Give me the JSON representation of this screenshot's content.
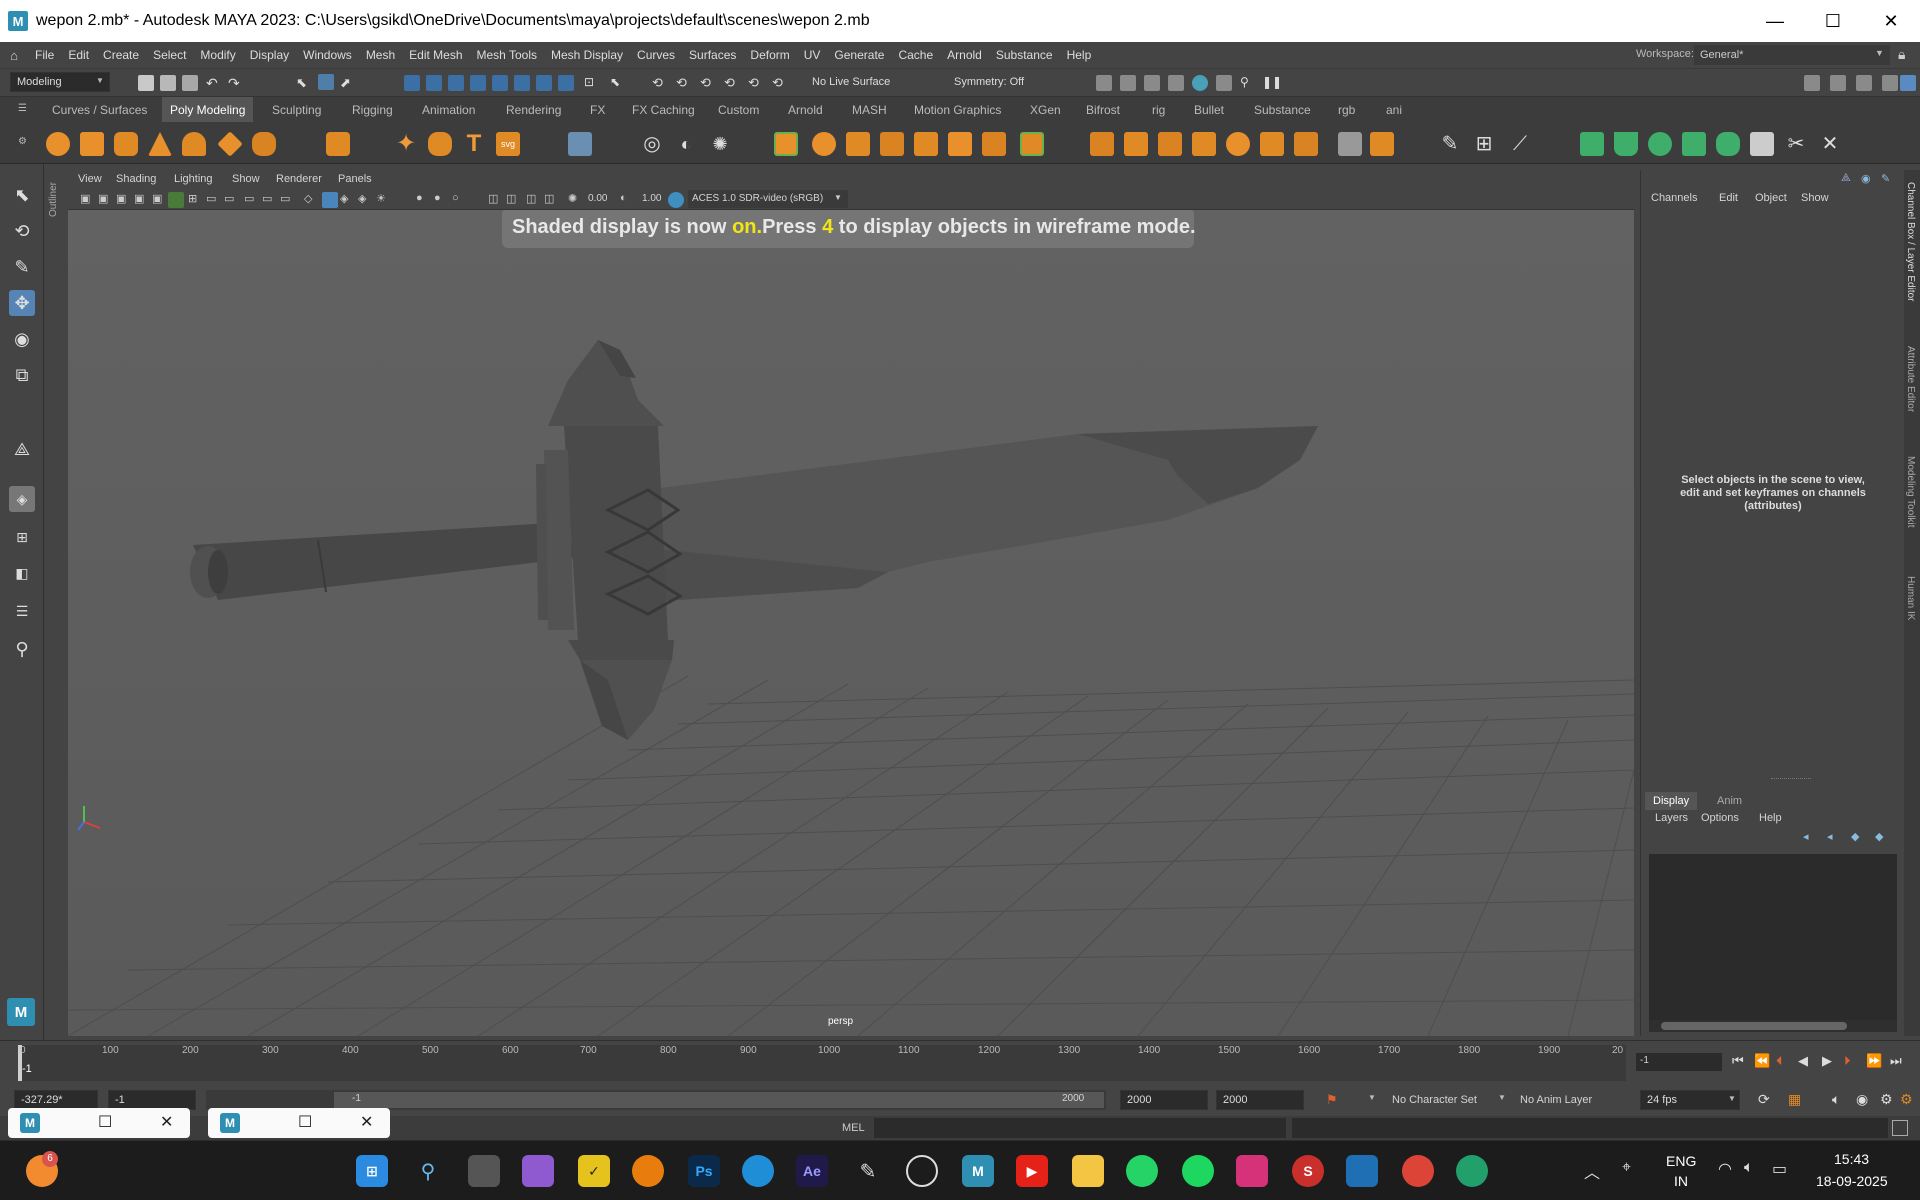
{
  "window": {
    "app_icon": "maya-logo-icon",
    "title": "wepon 2.mb* - Autodesk MAYA 2023: C:\\Users\\gsikd\\OneDrive\\Documents\\maya\\projects\\default\\scenes\\wepon 2.mb",
    "minimize": "—",
    "maximize": "☐",
    "close": "✕"
  },
  "menubar": {
    "items": [
      "File",
      "Edit",
      "Create",
      "Select",
      "Modify",
      "Display",
      "Windows",
      "Mesh",
      "Edit Mesh",
      "Mesh Tools",
      "Mesh Display",
      "Curves",
      "Surfaces",
      "Deform",
      "UV",
      "Generate",
      "Cache",
      "Arnold",
      "Substance",
      "Help"
    ],
    "workspace_label": "Workspace:",
    "workspace_value": "General*"
  },
  "statusline": {
    "menuset": "Modeling",
    "live_surface": "No Live Surface",
    "symmetry": "Symmetry: Off"
  },
  "shelf": {
    "tabs": [
      "Curves / Surfaces",
      "Poly Modeling",
      "Sculpting",
      "Rigging",
      "Animation",
      "Rendering",
      "FX",
      "FX Caching",
      "Custom",
      "Arnold",
      "MASH",
      "Motion Graphics",
      "XGen",
      "Bifrost",
      "rig",
      "Bullet",
      "Substance",
      "rgb",
      "ani"
    ],
    "active_tab": "Poly Modeling"
  },
  "toolbox": {
    "outliner_label": "Outliner"
  },
  "viewport": {
    "menu": [
      "View",
      "Shading",
      "Lighting",
      "Show",
      "Renderer",
      "Panels"
    ],
    "exposure": "0.00",
    "gamma": "1.00",
    "colorspace": "ACES 1.0 SDR-video (sRGB)",
    "hud_part1": "Shaded display is now ",
    "hud_on": "on.",
    "hud_part2": "Press ",
    "hud_key": "4",
    "hud_part3": " to display objects in wireframe mode.",
    "camera": "persp",
    "colors": {
      "hud_highlight": "#f2e417",
      "background": "#5f5f5f",
      "grid": "#4f4f4f"
    }
  },
  "channelbox": {
    "menu": [
      "Channels",
      "Edit",
      "Object",
      "Show"
    ],
    "hint": "Select objects in the scene to view, edit and set keyframes on channels (attributes)",
    "side_tabs": [
      "Channel Box / Layer Editor",
      "Attribute Editor",
      "Modeling Toolkit",
      "Human IK"
    ]
  },
  "layers": {
    "tabs": [
      "Display",
      "Anim"
    ],
    "menu": [
      "Layers",
      "Options",
      "Help"
    ]
  },
  "timeslider": {
    "ticks": [
      "0",
      "100",
      "200",
      "300",
      "400",
      "500",
      "600",
      "700",
      "800",
      "900",
      "1000",
      "1100",
      "1200",
      "1300",
      "1400",
      "1500",
      "1600",
      "1700",
      "1800",
      "1900",
      "20"
    ],
    "current_left": "-1",
    "current_field": "-1"
  },
  "rangeslider": {
    "coord": "-327.29*",
    "start": "-1",
    "range_start": "-1",
    "range_end": "2000",
    "end1": "2000",
    "end2": "2000",
    "character_set": "No Character Set",
    "anim_layer": "No Anim Layer",
    "fps": "24 fps"
  },
  "cmdline": {
    "label": "MEL"
  },
  "taskbar": {
    "lang_top": "ENG",
    "lang_bottom": "IN",
    "time": "15:43",
    "date": "18-09-2025",
    "notification_count": "6"
  }
}
